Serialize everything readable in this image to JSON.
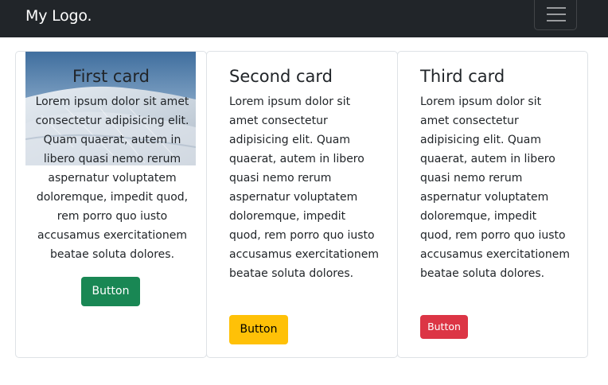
{
  "navbar": {
    "brand": "My Logo.",
    "toggler_icon": "hamburger-menu-icon"
  },
  "cards": [
    {
      "title": "First card",
      "text": "Lorem ipsum dolor sit amet consectetur adipisicing elit. Quam quaerat, autem in libero quasi nemo rerum aspernatur voluptatem doloremque, impedit quod, rem porro quo iusto accusamus exercitationem beatae soluta dolores.",
      "button": "Button",
      "button_color": "#198754",
      "image": "snowy-slope-image"
    },
    {
      "title": "Second card",
      "text": "Lorem ipsum dolor sit amet consectetur adipisicing elit. Quam quaerat, autem in libero quasi nemo rerum aspernatur voluptatem doloremque, impedit quod, rem porro quo iusto accusamus exercitationem beatae soluta dolores.",
      "button": "Button",
      "button_color": "#ffc107"
    },
    {
      "title": "Third card",
      "text": "Lorem ipsum dolor sit amet consectetur adipisicing elit. Quam quaerat, autem in libero quasi nemo rerum aspernatur voluptatem doloremque, impedit quod, rem porro quo iusto accusamus exercitationem beatae soluta dolores.",
      "button": "Button",
      "button_color": "#dc3545"
    }
  ]
}
